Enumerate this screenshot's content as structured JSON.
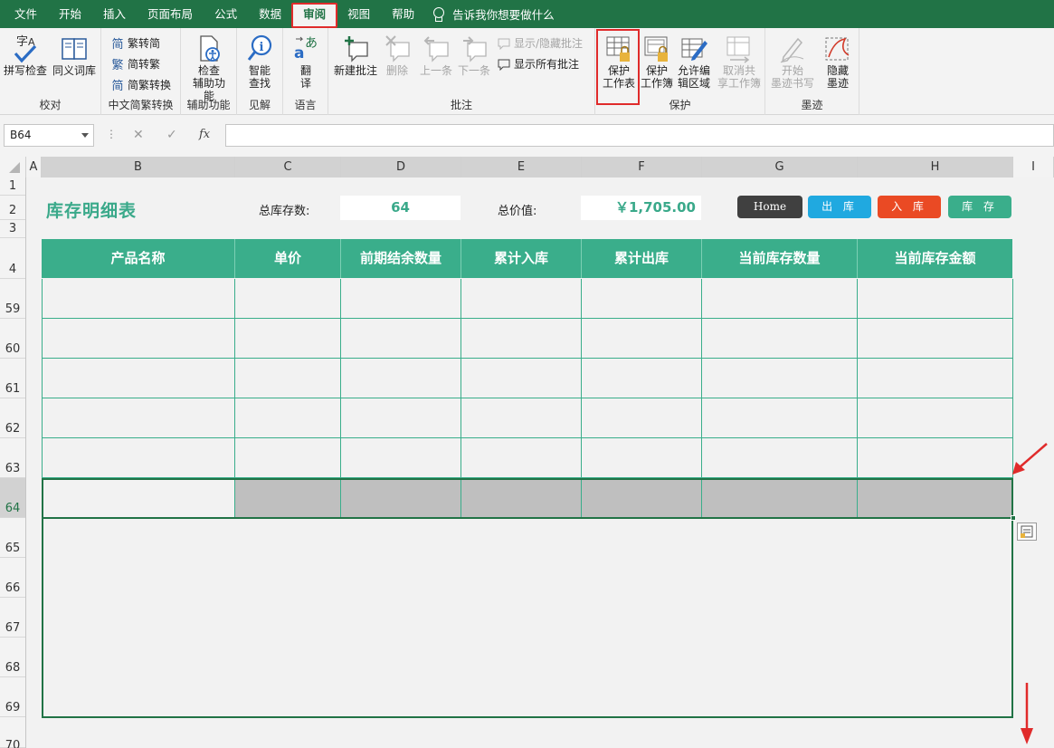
{
  "menu": {
    "tabs": [
      "文件",
      "开始",
      "插入",
      "页面布局",
      "公式",
      "数据",
      "审阅",
      "视图",
      "帮助"
    ],
    "active_tab": "审阅",
    "tell_me": "告诉我你想要做什么"
  },
  "ribbon": {
    "proofing": {
      "label": "校对",
      "spell": "拼写检查",
      "thesaurus": "同义词库"
    },
    "chinese": {
      "label": "中文简繁转换",
      "to_simplified": "繁转简",
      "to_traditional": "简转繁",
      "convert": "简繁转换"
    },
    "accessibility": {
      "label": "辅助功能",
      "check_line1": "检查",
      "check_line2": "辅助功能"
    },
    "insights": {
      "label": "见解",
      "smart_line1": "智能",
      "smart_line2": "查找"
    },
    "language": {
      "label": "语言",
      "translate_line1": "翻",
      "translate_line2": "译"
    },
    "comments": {
      "label": "批注",
      "new": "新建批注",
      "delete": "删除",
      "prev": "上一条",
      "next": "下一条",
      "show_hide": "显示/隐藏批注",
      "show_all": "显示所有批注"
    },
    "protect": {
      "label": "保护",
      "sheet_line1": "保护",
      "sheet_line2": "工作表",
      "book_line1": "保护",
      "book_line2": "工作簿",
      "edit_line1": "允许编",
      "edit_line2": "辑区域",
      "unshare_line1": "取消共",
      "unshare_line2": "享工作簿"
    },
    "ink": {
      "label": "墨迹",
      "start_line1": "开始",
      "start_line2": "墨迹书写",
      "hide_line1": "隐藏",
      "hide_line2": "墨迹"
    }
  },
  "formula_bar": {
    "name_box": "B64",
    "cancel": "✕",
    "enter": "✓",
    "fx": "fx",
    "value": ""
  },
  "columns": [
    "A",
    "B",
    "C",
    "D",
    "E",
    "F",
    "G",
    "H",
    "I"
  ],
  "rows": [
    "1",
    "2",
    "3",
    "4",
    "59",
    "60",
    "61",
    "62",
    "63",
    "64",
    "65",
    "66",
    "67",
    "68",
    "69",
    "70"
  ],
  "sheet": {
    "title": "库存明细表",
    "total_qty_label": "总库存数:",
    "total_qty": "64",
    "total_value_label": "总价值:",
    "total_value": "￥1,705.00",
    "buttons": [
      {
        "label": "Home",
        "color": "#404040"
      },
      {
        "label": "出 库",
        "color": "#20a9e0"
      },
      {
        "label": "入 库",
        "color": "#ea4a24"
      },
      {
        "label": "库 存",
        "color": "#3aae8b"
      }
    ],
    "table_headers": [
      "产品名称",
      "单价",
      "前期结余数量",
      "累计入库",
      "累计出库",
      "当前库存数量",
      "当前库存金额"
    ]
  },
  "colors": {
    "excel_green": "#217346",
    "table_green": "#3aae8b",
    "highlight_red": "#e02b2b",
    "selection_fill": "#bfbfbf"
  }
}
